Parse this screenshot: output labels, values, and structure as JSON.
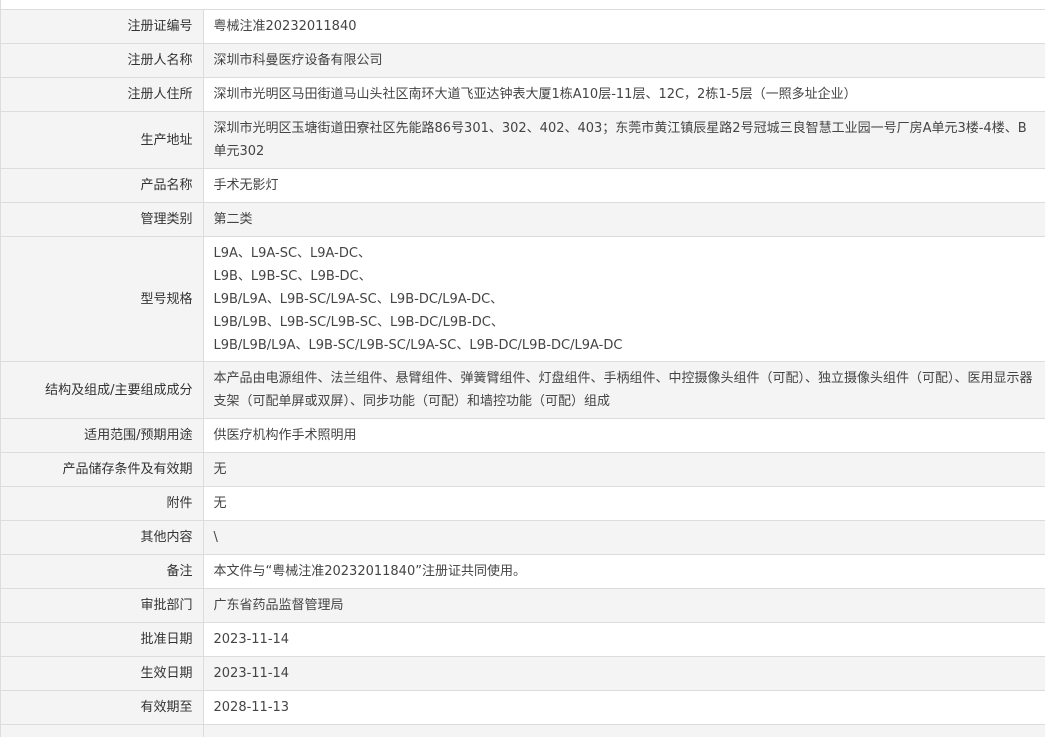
{
  "rows": [
    {
      "label": "注册证编号",
      "value": "粤械注准20232011840"
    },
    {
      "label": "注册人名称",
      "value": "深圳市科曼医疗设备有限公司"
    },
    {
      "label": "注册人住所",
      "value": "深圳市光明区马田街道马山头社区南环大道飞亚达钟表大厦1栋A10层-11层、12C，2栋1-5层（一照多址企业）"
    },
    {
      "label": "生产地址",
      "value": "深圳市光明区玉塘街道田寮社区先能路86号301、302、402、403；东莞市黄江镇辰星路2号冠城三良智慧工业园一号厂房A单元3楼-4楼、B单元302"
    },
    {
      "label": "产品名称",
      "value": "手术无影灯"
    },
    {
      "label": "管理类别",
      "value": "第二类"
    },
    {
      "label": "型号规格",
      "lines": [
        "L9A、L9A-SC、L9A-DC、",
        "L9B、L9B-SC、L9B-DC、",
        "L9B/L9A、L9B-SC/L9A-SC、L9B-DC/L9A-DC、",
        "L9B/L9B、L9B-SC/L9B-SC、L9B-DC/L9B-DC、",
        "L9B/L9B/L9A、L9B-SC/L9B-SC/L9A-SC、L9B-DC/L9B-DC/L9A-DC"
      ]
    },
    {
      "label": "结构及组成/主要组成成分",
      "value": "本产品由电源组件、法兰组件、悬臂组件、弹簧臂组件、灯盘组件、手柄组件、中控摄像头组件（可配）、独立摄像头组件（可配）、医用显示器支架（可配单屏或双屏）、同步功能（可配）和墙控功能（可配）组成"
    },
    {
      "label": "适用范围/预期用途",
      "value": "供医疗机构作手术照明用"
    },
    {
      "label": "产品储存条件及有效期",
      "value": "无"
    },
    {
      "label": "附件",
      "value": "无"
    },
    {
      "label": "其他内容",
      "value": "\\"
    },
    {
      "label": "备注",
      "value": "本文件与“粤械注准20232011840”注册证共同使用。"
    },
    {
      "label": "审批部门",
      "value": "广东省药品监督管理局"
    },
    {
      "label": "批准日期",
      "value": "2023-11-14"
    },
    {
      "label": "生效日期",
      "value": "2023-11-14"
    },
    {
      "label": "有效期至",
      "value": "2028-11-13"
    }
  ]
}
